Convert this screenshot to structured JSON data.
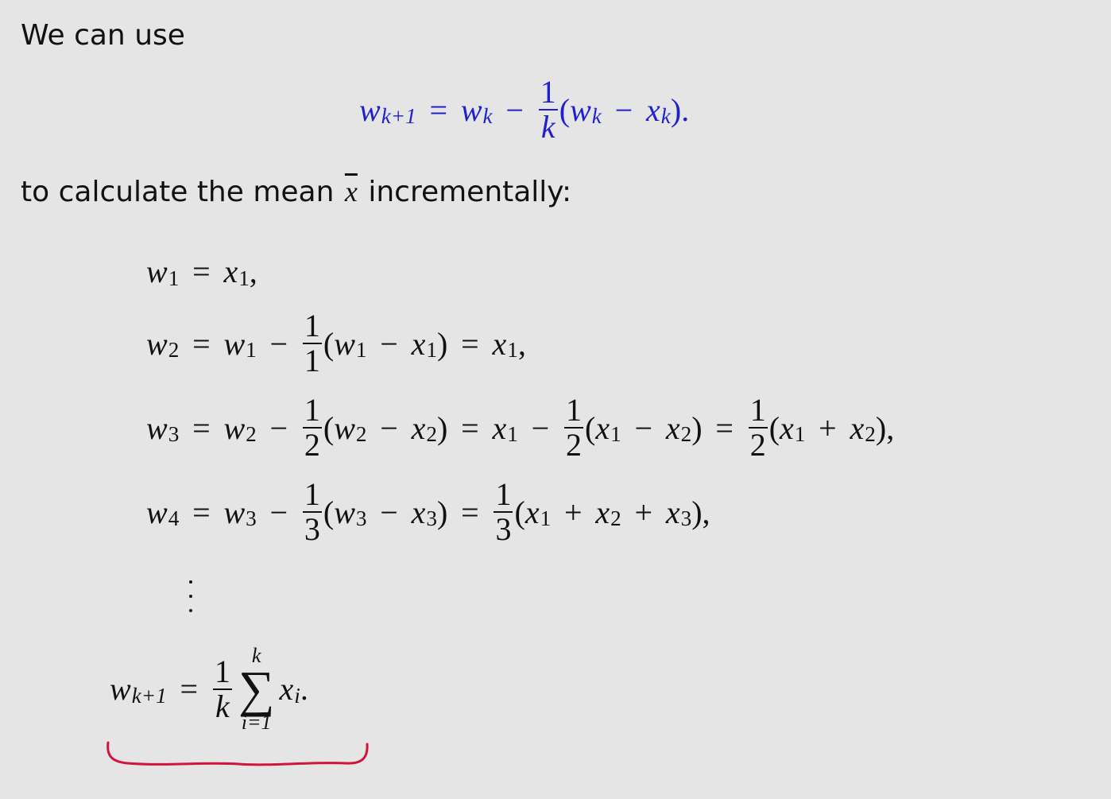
{
  "intro_text": "We can use",
  "middle_text_before": "to calculate the mean",
  "middle_symbol": "x",
  "middle_text_after": "incrementally:",
  "update_rule": {
    "lhs_var": "w",
    "lhs_sub": "k+1",
    "rhs_var": "w",
    "rhs_sub": "k",
    "frac_num": "1",
    "frac_den": "k",
    "paren_var1": "w",
    "paren_sub1": "k",
    "paren_var2": "x",
    "paren_sub2": "k",
    "end": ")."
  },
  "lines": {
    "l1": {
      "lhs": "w",
      "lhs_sub": "1",
      "rhs": "x",
      "rhs_sub": "1",
      "end": ","
    },
    "l2": {
      "lhs": "w",
      "lhs_sub": "2",
      "w": "w",
      "w_sub": "1",
      "num": "1",
      "den": "1",
      "a": "w",
      "a_sub": "1",
      "b": "x",
      "b_sub": "1",
      "r": "x",
      "r_sub": "1",
      "end": ","
    },
    "l3": {
      "lhs": "w",
      "lhs_sub": "3",
      "w": "w",
      "w_sub": "2",
      "num": "1",
      "den": "2",
      "a": "w",
      "a_sub": "2",
      "b": "x",
      "b_sub": "2",
      "r1": "x",
      "r1_sub": "1",
      "num2": "1",
      "den2": "2",
      "c": "x",
      "c_sub": "1",
      "d": "x",
      "d_sub": "2",
      "num3": "1",
      "den3": "2",
      "e": "x",
      "e_sub": "1",
      "f": "x",
      "f_sub": "2",
      "end": "),"
    },
    "l4": {
      "lhs": "w",
      "lhs_sub": "4",
      "w": "w",
      "w_sub": "3",
      "num": "1",
      "den": "3",
      "a": "w",
      "a_sub": "3",
      "b": "x",
      "b_sub": "3",
      "num2": "1",
      "den2": "3",
      "c": "x",
      "c_sub": "1",
      "d": "x",
      "d_sub": "2",
      "e": "x",
      "e_sub": "3",
      "end": "),"
    }
  },
  "final": {
    "lhs": "w",
    "lhs_sub": "k+1",
    "num": "1",
    "den": "k",
    "sum_top": "k",
    "sum_bottom": "i=1",
    "term": "x",
    "term_sub": "i",
    "end": "."
  },
  "colors": {
    "background": "#e5e5e5",
    "text": "#111111",
    "highlight_equation": "#1f1fcc",
    "annotation_brace": "#d0143c"
  }
}
